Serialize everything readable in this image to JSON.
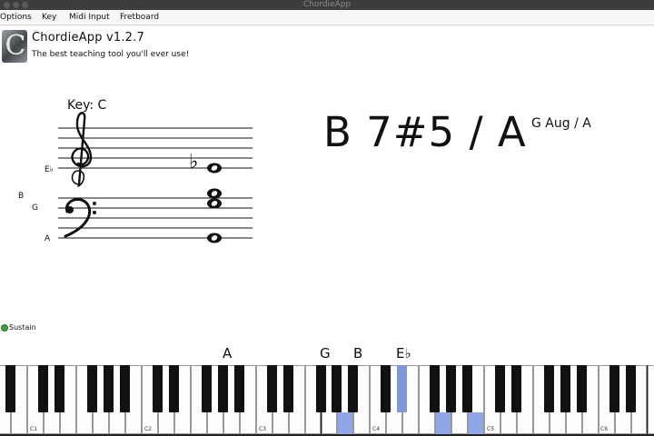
{
  "window": {
    "title": "ChordieApp"
  },
  "menu": {
    "items": [
      "Options",
      "Key",
      "Midi Input",
      "Fretboard"
    ]
  },
  "header": {
    "title": "ChordieApp v1.2.7",
    "tagline": "The best teaching tool you'll ever use!"
  },
  "notation": {
    "key_label": "Key: C",
    "note_labels": {
      "eflat": "E♭",
      "b": "B",
      "g": "G",
      "a": "A"
    },
    "accidental": "♭"
  },
  "chords": {
    "main": "B 7#5 / A",
    "alternate": "G Aug / A"
  },
  "sustain": {
    "label": "Sustain",
    "color": "#3ea53e"
  },
  "piano": {
    "octave_labels": [
      "C1",
      "C2",
      "C3",
      "C4",
      "C5",
      "C6"
    ],
    "pressed_labels": [
      "A",
      "G",
      "B",
      "E♭"
    ],
    "highlight_color": "#8fa7e4"
  }
}
